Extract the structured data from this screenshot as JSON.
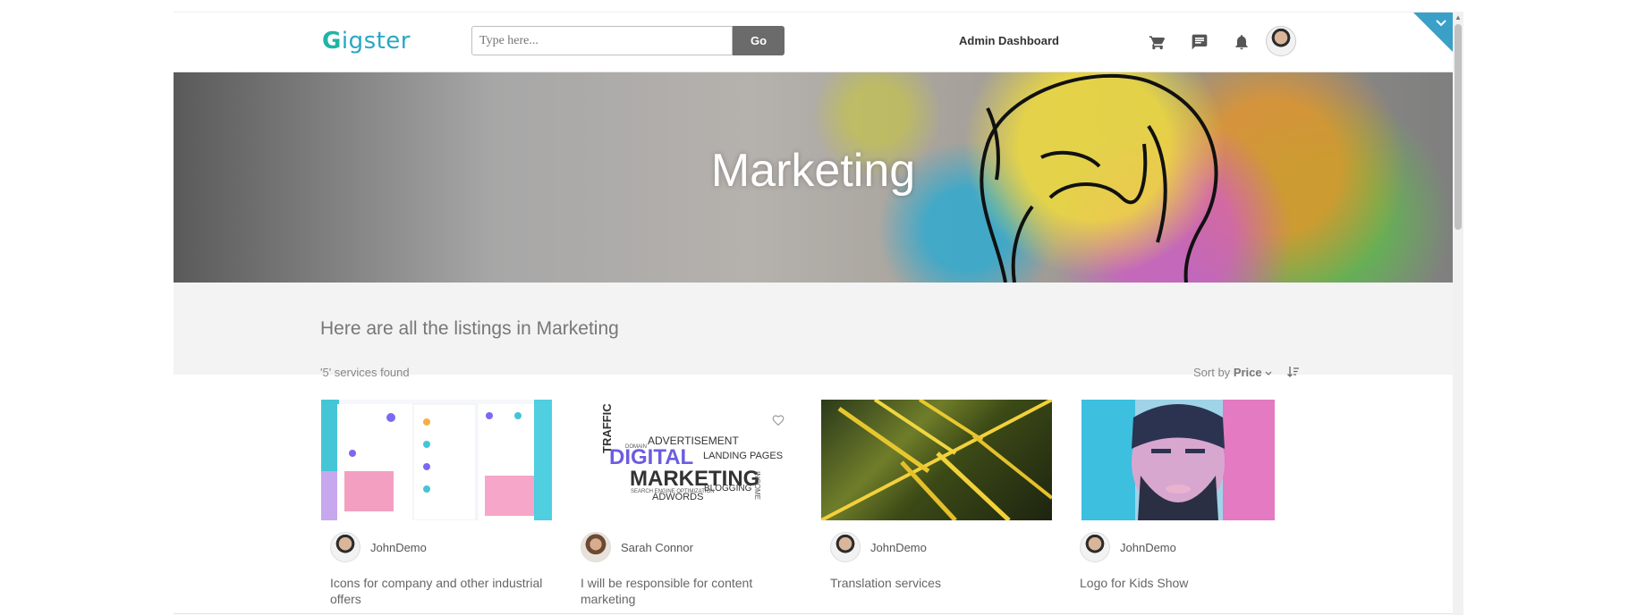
{
  "header": {
    "logo": "Gigster",
    "search_placeholder": "Type here...",
    "go_label": "Go",
    "admin_link": "Admin Dashboard",
    "icons": [
      "cart-icon",
      "chat-icon",
      "bell-icon",
      "avatar"
    ]
  },
  "banner": {
    "title": "Marketing"
  },
  "listing": {
    "heading": "Here are all the listings in Marketing",
    "count": "'5' services found",
    "sort_prefix": "Sort by",
    "sort_value": "Price"
  },
  "cards": [
    {
      "seller": "JohnDemo",
      "title": "Icons for company and other industrial offers"
    },
    {
      "seller": "Sarah Connor",
      "title": "I will be responsible for content marketing"
    },
    {
      "seller": "JohnDemo",
      "title": "Translation services"
    },
    {
      "seller": "JohnDemo",
      "title": "Logo for Kids Show"
    }
  ],
  "wordcloud": {
    "words": [
      "ADVERTISEMENT",
      "DIGITAL",
      "LANDING PAGES",
      "MARKETING",
      "TRAFFIC",
      "ADWORDS",
      "BLOGGING",
      "SEARCH ENGINE OPTIMIZATION",
      "DOMAIN",
      "INCOME"
    ]
  },
  "colors": {
    "accent": "#29a7c6",
    "go_button": "#6b6b6b",
    "corner": "#3aa0c8"
  }
}
